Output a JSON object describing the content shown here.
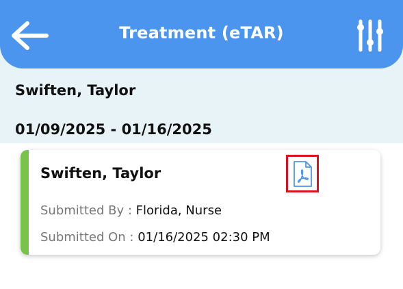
{
  "header": {
    "title": "Treatment (eTAR)",
    "back_icon": "arrow-left-icon",
    "filter_icon": "sliders-icon",
    "background_color": "#4b95ee"
  },
  "patient": {
    "name": "Swiften, Taylor",
    "date_range": "01/09/2025 - 01/16/2025"
  },
  "record": {
    "name": "Swiften, Taylor",
    "submitted_by_label": "Submitted By : ",
    "submitted_by_value": "Florida, Nurse",
    "submitted_on_label": "Submitted On : ",
    "submitted_on_value": "01/16/2025 02:30 PM",
    "pdf_icon": "pdf-file-icon",
    "accent_color": "#78c44a",
    "highlight_color": "#d9131f"
  }
}
